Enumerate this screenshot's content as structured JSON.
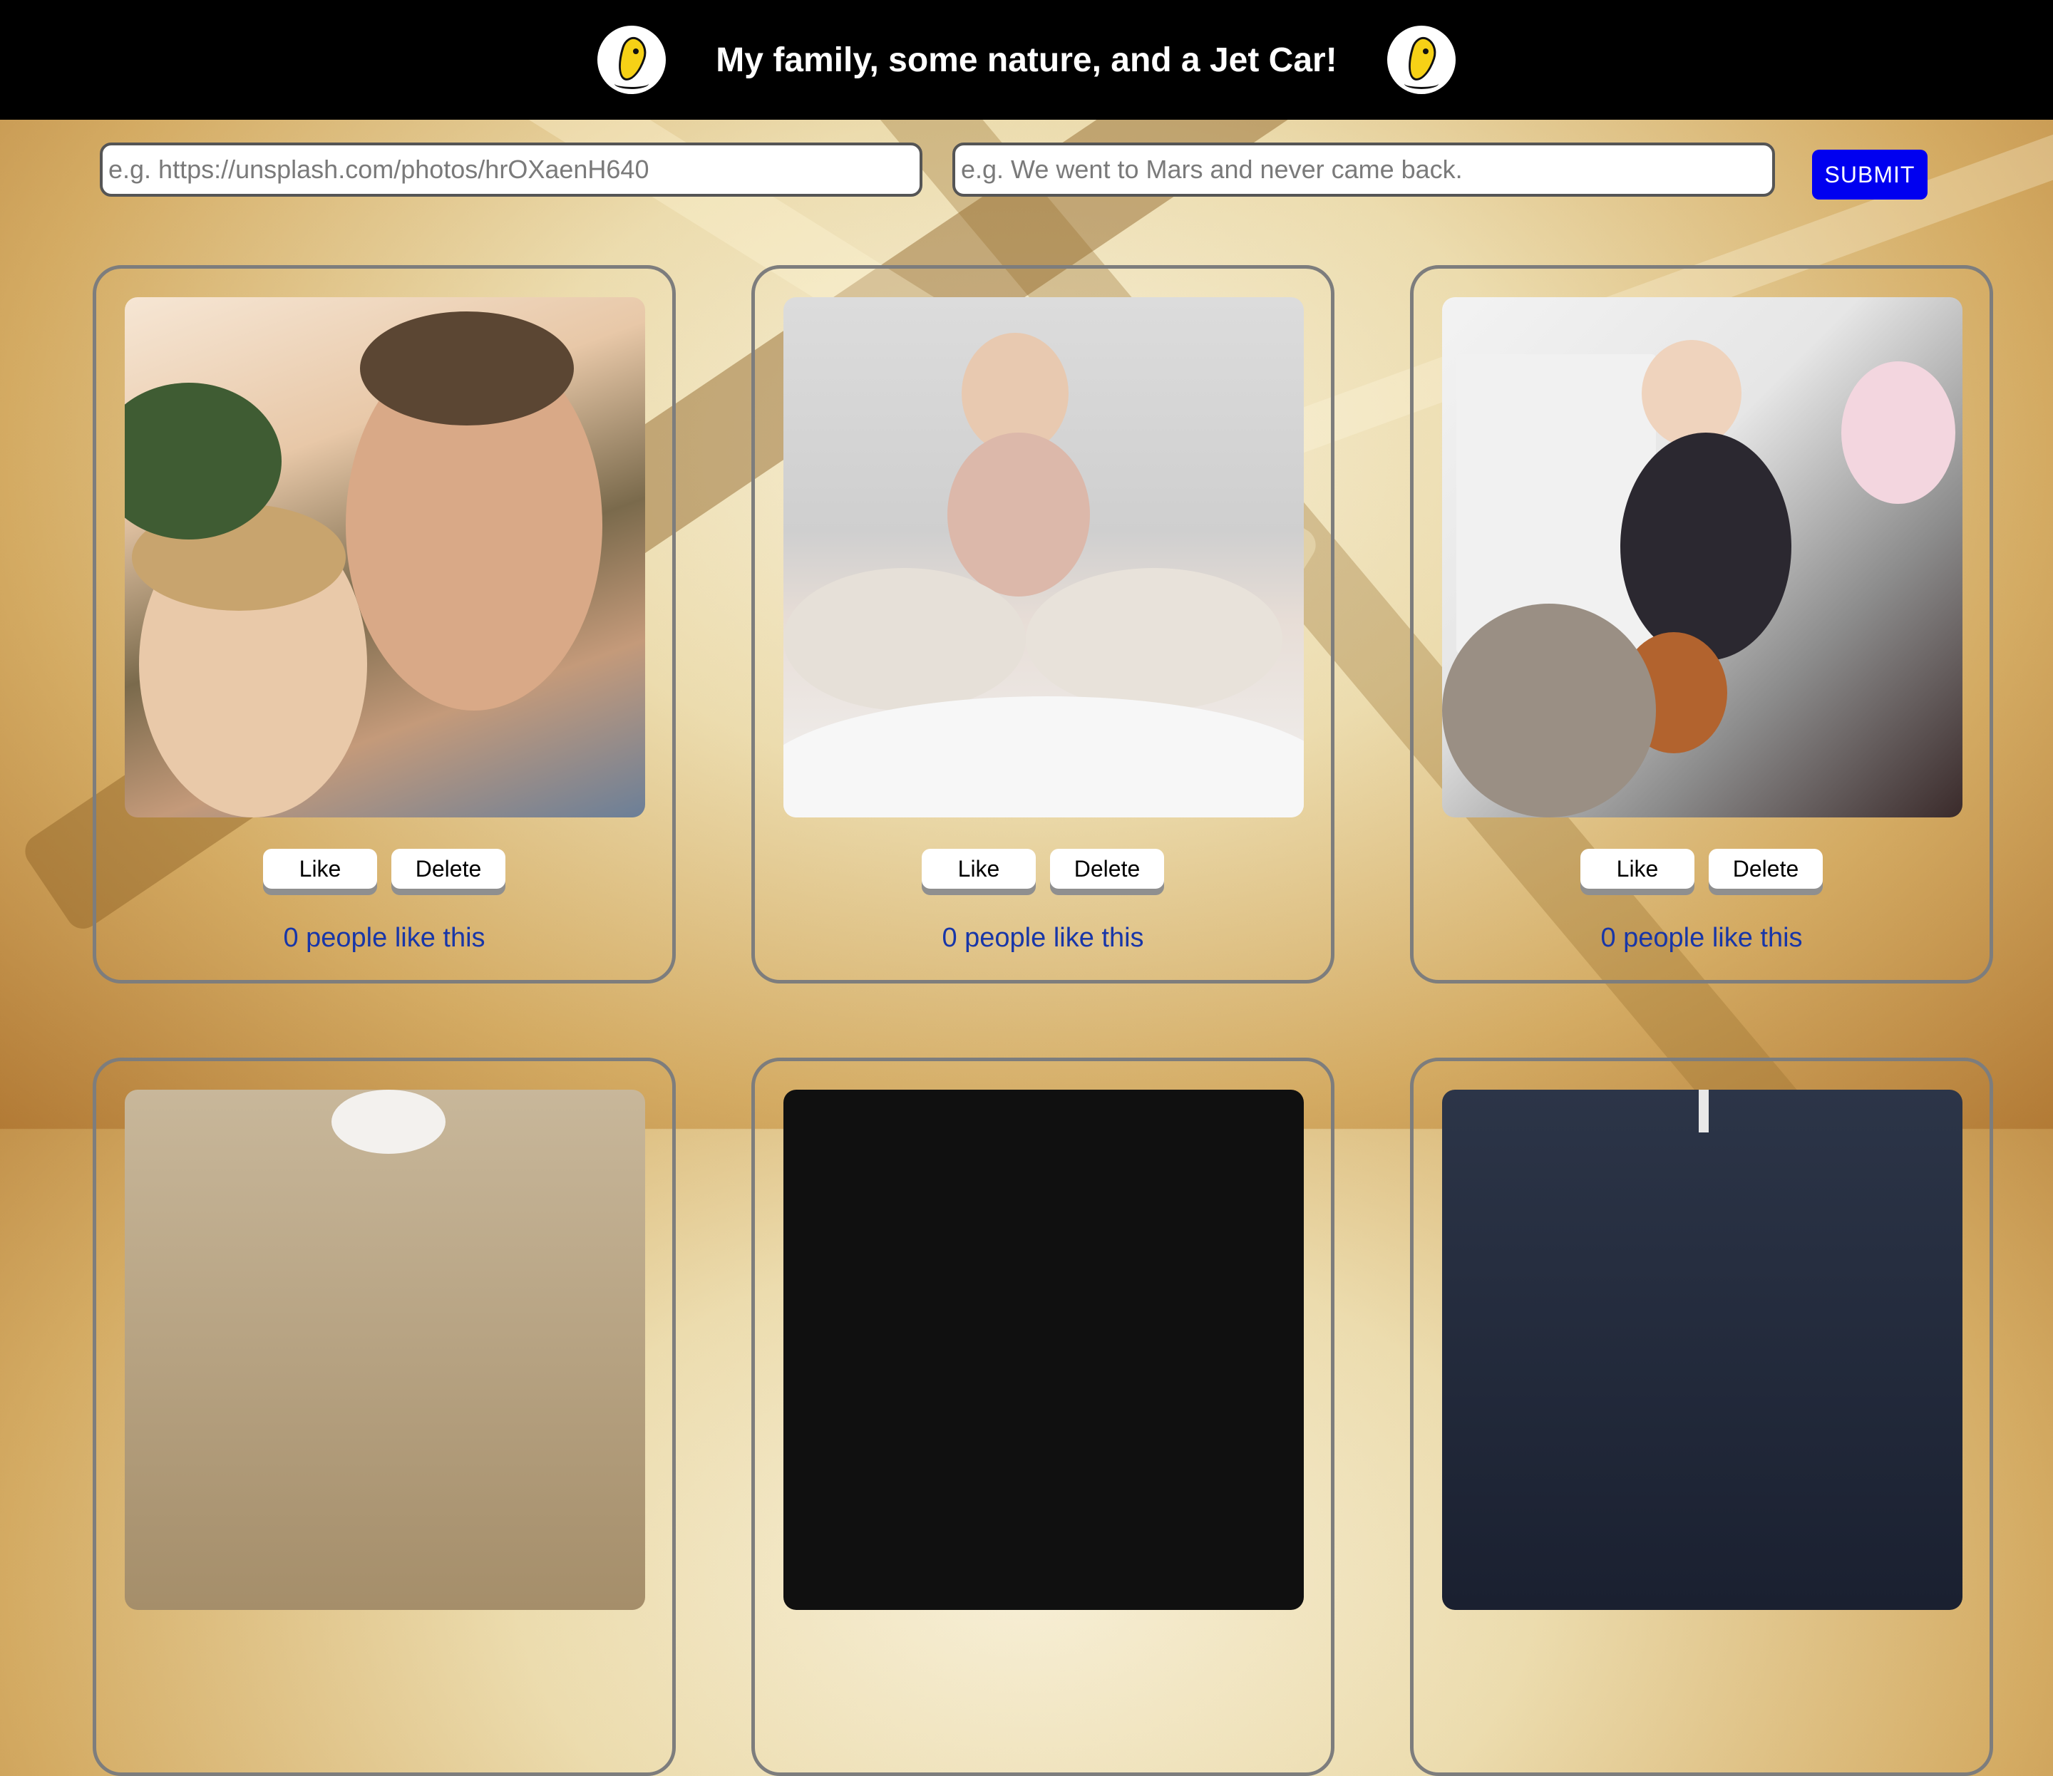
{
  "header": {
    "title": "My family, some nature, and a Jet Car!",
    "logo_icon": "dancing-banana-icon"
  },
  "form": {
    "url_placeholder": "e.g. https://unsplash.com/photos/hrOXaenH640",
    "caption_placeholder": "e.g. We went to Mars and never came back.",
    "submit_label": "SUBMIT"
  },
  "cards": [
    {
      "like_label": "Like",
      "delete_label": "Delete",
      "likes_text": "0 people like this"
    },
    {
      "like_label": "Like",
      "delete_label": "Delete",
      "likes_text": "0 people like this"
    },
    {
      "like_label": "Like",
      "delete_label": "Delete",
      "likes_text": "0 people like this"
    }
  ],
  "colors": {
    "header_bg": "#000000",
    "submit_bg": "#0000f0",
    "likes_text": "#1836a8",
    "card_border": "#7d7d7d"
  }
}
